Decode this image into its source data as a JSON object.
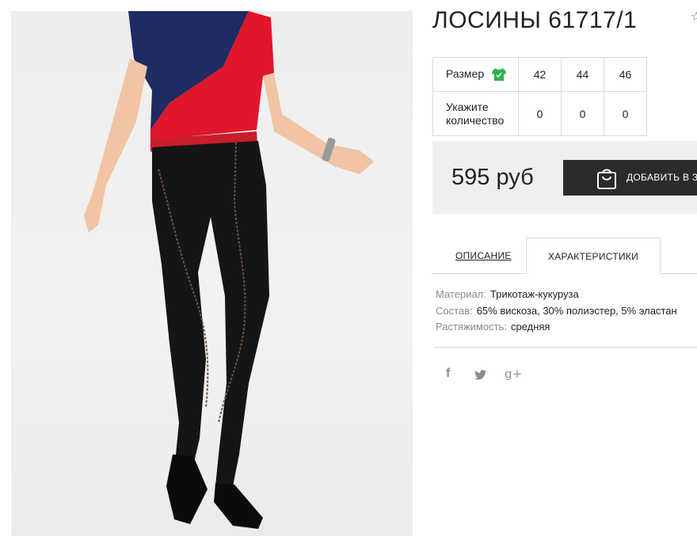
{
  "product": {
    "title": "ЛОСИНЫ 61717/1",
    "image_alt": "product-photo"
  },
  "size_table": {
    "size_label": "Размер",
    "size_icon": "shirt-icon",
    "size_icon_color": "#2db34a",
    "sizes": [
      "42",
      "44",
      "46"
    ],
    "qty_label": "Укажите количество",
    "quantities": [
      "0",
      "0",
      "0"
    ]
  },
  "purchase": {
    "price": "595 руб",
    "add_to_cart_label": "ДОБАВИТЬ В З",
    "button_color": "#2b2b2b",
    "button_icon": "shopping-bag-icon"
  },
  "tabs": [
    {
      "label": "ОПИСАНИЕ",
      "active": false
    },
    {
      "label": "ХАРАКТЕРИСТИКИ",
      "active": true
    }
  ],
  "characteristics": [
    {
      "key": "Материал:",
      "value": "Трикотаж-кукуруза"
    },
    {
      "key": "Состав:",
      "value": "65% вискоза, 30% полиэстер, 5% эластан"
    },
    {
      "key": "Растяжимость:",
      "value": "средняя"
    }
  ],
  "social": [
    {
      "name": "facebook-icon",
      "glyph": "f"
    },
    {
      "name": "twitter-icon",
      "glyph": ""
    },
    {
      "name": "google-plus-icon",
      "glyph": "g+"
    }
  ]
}
